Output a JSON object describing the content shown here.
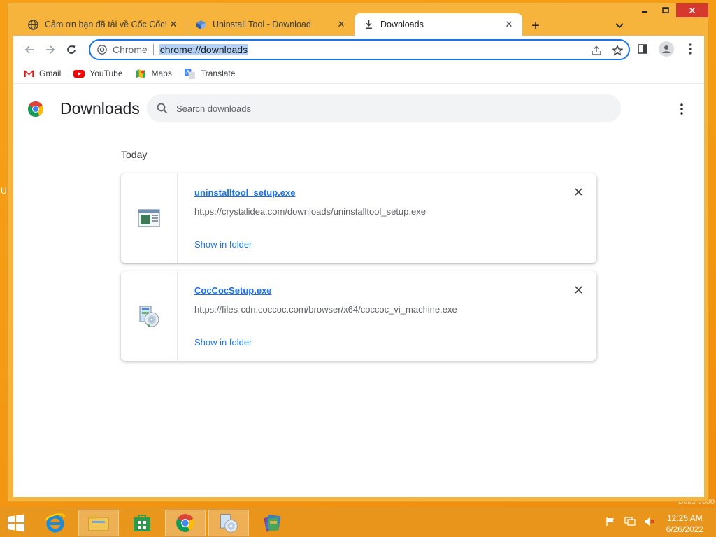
{
  "browser": {
    "tabs": [
      {
        "title": "Cảm ơn bạn đã tải về Cốc Cốc!",
        "icon": "globe-icon"
      },
      {
        "title": "Uninstall Tool - Download",
        "icon": "uninstall-tool-icon"
      },
      {
        "title": "Downloads",
        "icon": "download-icon"
      }
    ],
    "omnibox": {
      "scheme_label": "Chrome",
      "url": "chrome://downloads"
    },
    "bookmarks": [
      {
        "label": "Gmail",
        "icon": "gmail-icon"
      },
      {
        "label": "YouTube",
        "icon": "youtube-icon"
      },
      {
        "label": "Maps",
        "icon": "maps-icon"
      },
      {
        "label": "Translate",
        "icon": "translate-icon"
      }
    ]
  },
  "page": {
    "title": "Downloads",
    "search_placeholder": "Search downloads",
    "section_label": "Today",
    "downloads": [
      {
        "file_name": "uninstalltool_setup.exe",
        "url": "https://crystalidea.com/downloads/uninstalltool_setup.exe",
        "action": "Show in folder",
        "icon": "installer-window-icon"
      },
      {
        "file_name": "CocCocSetup.exe",
        "url": "https://files-cdn.coccoc.com/browser/x64/coccoc_vi_machine.exe",
        "action": "Show in folder",
        "icon": "setup-disc-icon"
      }
    ]
  },
  "desktop": {
    "left_label": "U",
    "right_label": "Build 9600"
  },
  "taskbar": {
    "clock_time": "12:25 AM",
    "clock_date": "6/26/2022"
  },
  "colors": {
    "accent": "#1a73e8",
    "desktop": "#f59a14",
    "window_frame": "#f6b43c",
    "close_button": "#d5382c"
  }
}
